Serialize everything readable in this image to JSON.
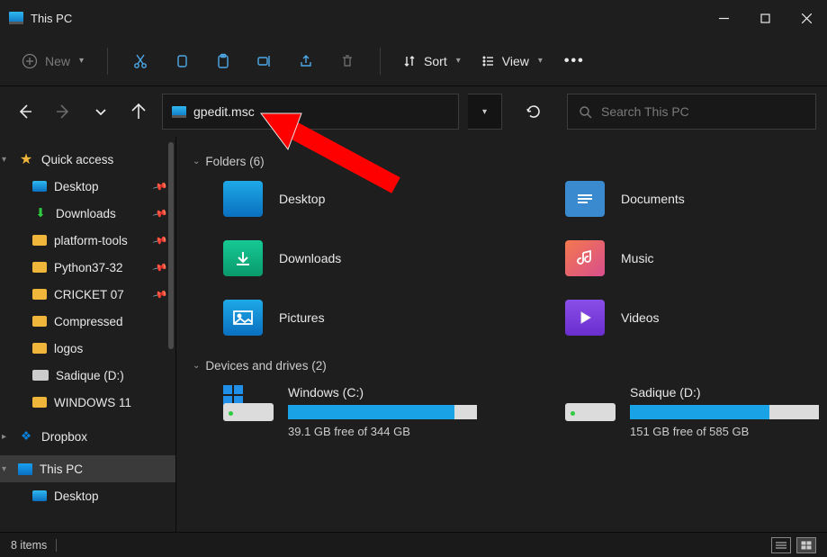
{
  "title": "This PC",
  "toolbar": {
    "new_label": "New",
    "sort_label": "Sort",
    "view_label": "View"
  },
  "address": {
    "value": "gpedit.msc"
  },
  "search": {
    "placeholder": "Search This PC"
  },
  "sidebar": {
    "quick_access": "Quick access",
    "items": [
      {
        "label": "Desktop",
        "pinned": true
      },
      {
        "label": "Downloads",
        "pinned": true
      },
      {
        "label": "platform-tools",
        "pinned": true
      },
      {
        "label": "Python37-32",
        "pinned": true
      },
      {
        "label": "CRICKET 07",
        "pinned": true
      },
      {
        "label": "Compressed",
        "pinned": false
      },
      {
        "label": "logos",
        "pinned": false
      },
      {
        "label": "Sadique (D:)",
        "pinned": false
      },
      {
        "label": "WINDOWS 11",
        "pinned": false
      }
    ],
    "dropbox": "Dropbox",
    "this_pc": "This PC",
    "desktop_sub": "Desktop"
  },
  "sections": {
    "folders_header": "Folders (6)",
    "drives_header": "Devices and drives (2)"
  },
  "folders": [
    {
      "label": "Desktop"
    },
    {
      "label": "Documents"
    },
    {
      "label": "Downloads"
    },
    {
      "label": "Music"
    },
    {
      "label": "Pictures"
    },
    {
      "label": "Videos"
    }
  ],
  "drives": [
    {
      "label": "Windows (C:)",
      "free": "39.1 GB free of 344 GB",
      "fill_pct": 88
    },
    {
      "label": "Sadique (D:)",
      "free": "151 GB free of 585 GB",
      "fill_pct": 74
    }
  ],
  "status": {
    "items": "8 items"
  }
}
